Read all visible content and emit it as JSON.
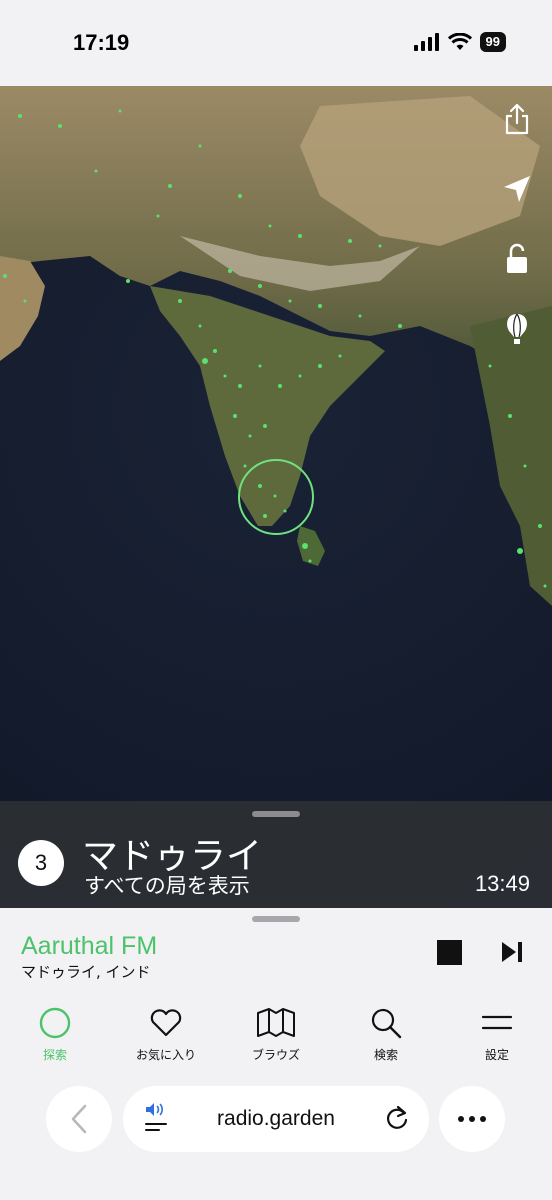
{
  "status": {
    "time": "17:19",
    "battery": "99"
  },
  "map": {
    "controls": [
      "share-icon",
      "locate-arrow-icon",
      "unlock-icon",
      "balloon-icon"
    ]
  },
  "location": {
    "count": "3",
    "name": "マドゥライ",
    "subtitle": "すべての局を表示",
    "local_time": "13:49"
  },
  "player": {
    "station": "Aaruthal FM",
    "place": "マドゥライ, インド"
  },
  "tabs": [
    {
      "label": "探索",
      "icon": "explore-circle-icon",
      "active": true
    },
    {
      "label": "お気に入り",
      "icon": "heart-icon",
      "active": false
    },
    {
      "label": "ブラウズ",
      "icon": "map-icon",
      "active": false
    },
    {
      "label": "検索",
      "icon": "search-icon",
      "active": false
    },
    {
      "label": "設定",
      "icon": "menu-icon",
      "active": false
    }
  ],
  "browser": {
    "url": "radio.garden"
  },
  "colors": {
    "accent": "#4cc36a",
    "map_edge": "#4b2cf0",
    "ocean": "#121a2b"
  }
}
